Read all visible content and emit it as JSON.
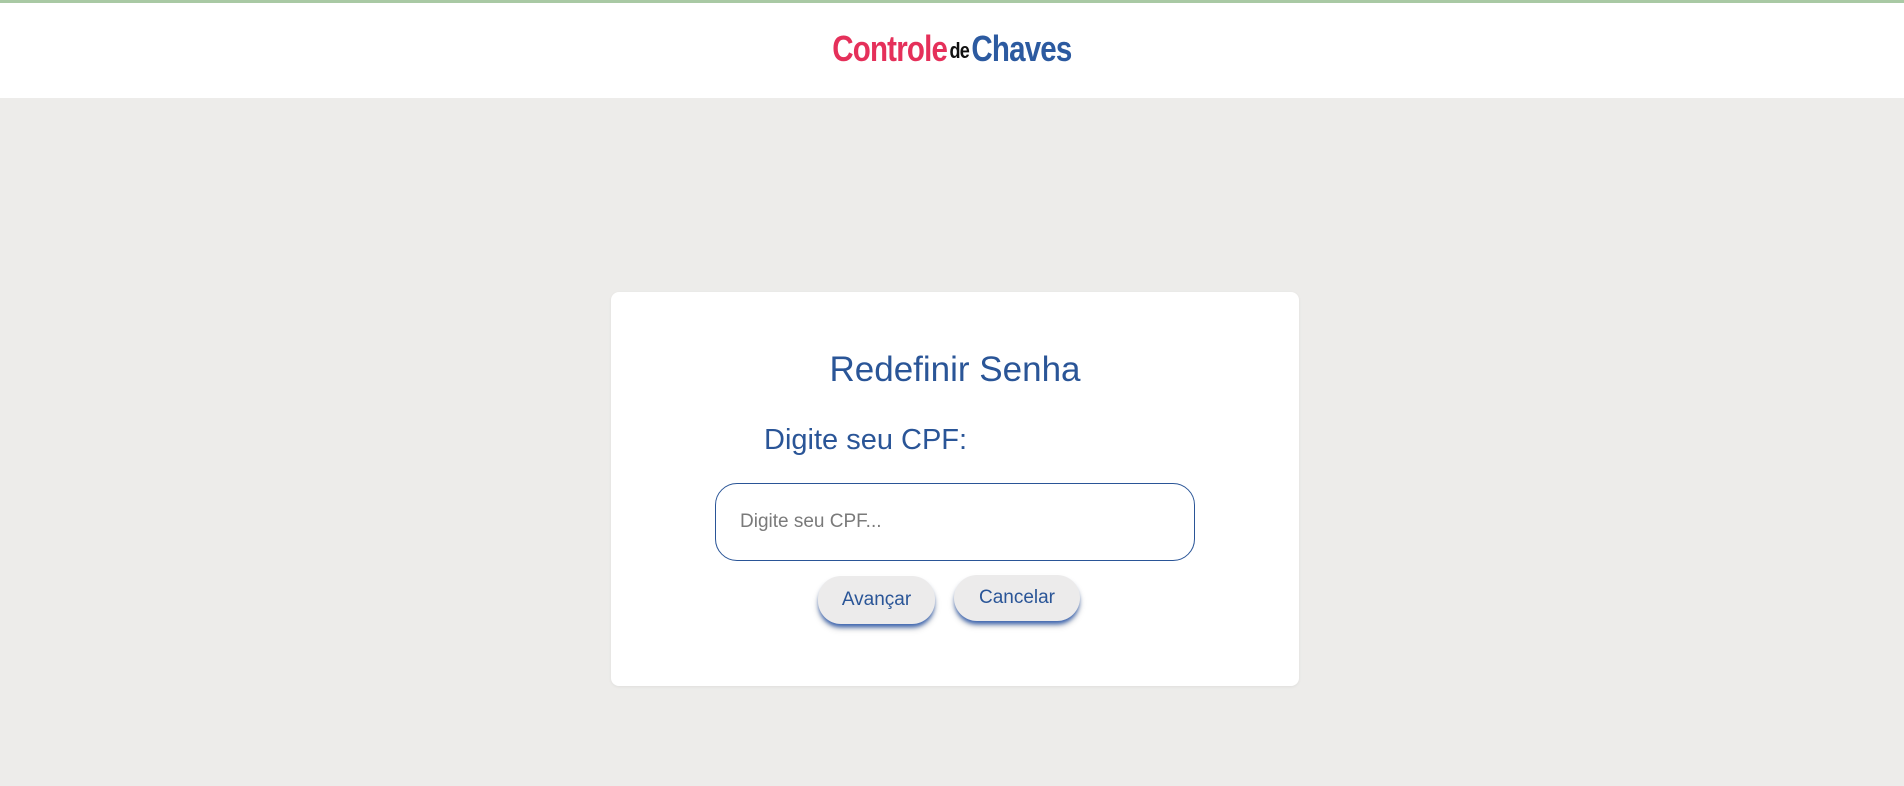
{
  "header": {
    "logo": {
      "part1": "Controle",
      "part2": "de",
      "part3": "Chaves"
    }
  },
  "card": {
    "title": "Redefinir Senha",
    "cpf_label": "Digite seu CPF:",
    "cpf_input": {
      "value": "",
      "placeholder": "Digite seu CPF..."
    },
    "buttons": {
      "next_label": "Avançar",
      "cancel_label": "Cancelar"
    }
  },
  "colors": {
    "brand_red": "#e5305a",
    "brand_blue": "#2c5aa0",
    "text_blue": "#2a5597",
    "background": "#edecea"
  }
}
